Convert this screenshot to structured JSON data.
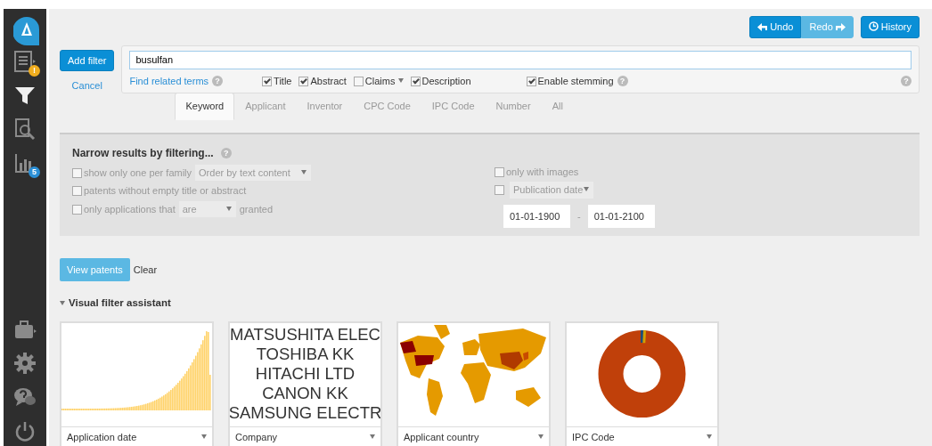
{
  "sidebar": {
    "top": [
      {
        "kind": "logo"
      },
      {
        "kind": "report",
        "badge": {
          "label": "!",
          "color": "#f0ad1e"
        }
      },
      {
        "kind": "filter"
      },
      {
        "kind": "search"
      },
      {
        "kind": "chart",
        "badge": {
          "label": "5",
          "color": "#2a8fd6"
        }
      }
    ],
    "bottom": [
      {
        "kind": "toolbox"
      },
      {
        "kind": "settings"
      },
      {
        "kind": "help"
      },
      {
        "kind": "power"
      }
    ]
  },
  "toolbar": {
    "undo": {
      "label": "Undo",
      "disabled": false
    },
    "redo": {
      "label": "Redo",
      "disabled": true
    },
    "history": {
      "label": "History"
    }
  },
  "filter": {
    "add_button": "Add filter",
    "cancel": "Cancel",
    "query": "busulfan",
    "related": "Find related terms",
    "related_help": "?",
    "panel_help": "?",
    "fields": [
      {
        "label": "Title",
        "checked": true,
        "dropdown": false
      },
      {
        "label": "Abstract",
        "checked": true,
        "dropdown": false
      },
      {
        "label": "Claims",
        "checked": false,
        "dropdown": true
      },
      {
        "label": "Description",
        "checked": true,
        "dropdown": false
      }
    ],
    "stemming": {
      "label": "Enable stemming",
      "checked": true,
      "help": "?"
    },
    "tabs": [
      {
        "label": "Keyword",
        "selected": true
      },
      {
        "label": "Applicant",
        "selected": false
      },
      {
        "label": "Inventor",
        "selected": false
      },
      {
        "label": "CPC Code",
        "selected": false
      },
      {
        "label": "IPC Code",
        "selected": false
      },
      {
        "label": "Number",
        "selected": false
      },
      {
        "label": "All",
        "selected": false
      }
    ]
  },
  "narrow": {
    "title": "Narrow results by filtering...",
    "help": "?",
    "left": [
      {
        "label": "show only one per family",
        "checked": false,
        "select": "Order by text content"
      },
      {
        "label": "patents without empty title or abstract",
        "checked": false
      },
      {
        "label": "only applications that",
        "checked": false,
        "select": "are",
        "suffix": "granted"
      }
    ],
    "right": [
      {
        "label": "only with images",
        "checked": false
      },
      {
        "checked": false,
        "select": "Publication date"
      }
    ],
    "date_from": "01-01-1900",
    "date_sep": "-",
    "date_to": "01-01-2100"
  },
  "actions": {
    "view": "View patents",
    "clear": "Clear"
  },
  "assistant": {
    "title": "Visual filter assistant",
    "expanded": true,
    "cards": [
      {
        "kind": "histogram",
        "label": "Application date"
      },
      {
        "kind": "words",
        "label": "Company",
        "words": [
          "MATSUSHITA ELEC",
          "TOSHIBA KK",
          "HITACHI LTD",
          "CANON KK",
          "SAMSUNG ELECTR"
        ]
      },
      {
        "kind": "map",
        "label": "Applicant country"
      },
      {
        "kind": "donut",
        "label": "IPC Code"
      }
    ]
  }
}
